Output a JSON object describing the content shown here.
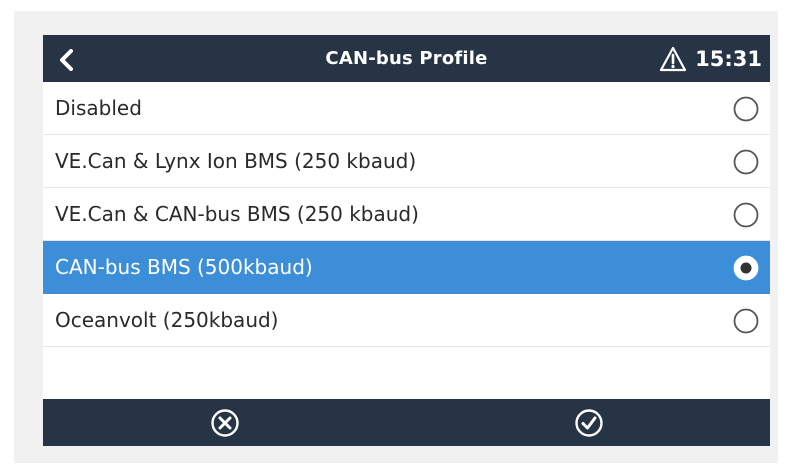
{
  "header": {
    "title": "CAN-bus Profile",
    "time": "15:31",
    "warning_icon": "warning-triangle-icon",
    "back_icon": "chevron-left-icon"
  },
  "options": [
    {
      "label": "Disabled",
      "selected": false
    },
    {
      "label": "VE.Can & Lynx Ion BMS (250 kbaud)",
      "selected": false
    },
    {
      "label": "VE.Can & CAN-bus BMS (250 kbaud)",
      "selected": false
    },
    {
      "label": "CAN-bus BMS (500kbaud)",
      "selected": true
    },
    {
      "label": "Oceanvolt (250kbaud)",
      "selected": false
    }
  ],
  "footer": {
    "cancel_icon": "cancel-circle-icon",
    "confirm_icon": "check-circle-icon"
  },
  "colors": {
    "header_bg": "#273445",
    "selected_bg": "#3c8ed8",
    "text": "#2a2a2a"
  }
}
